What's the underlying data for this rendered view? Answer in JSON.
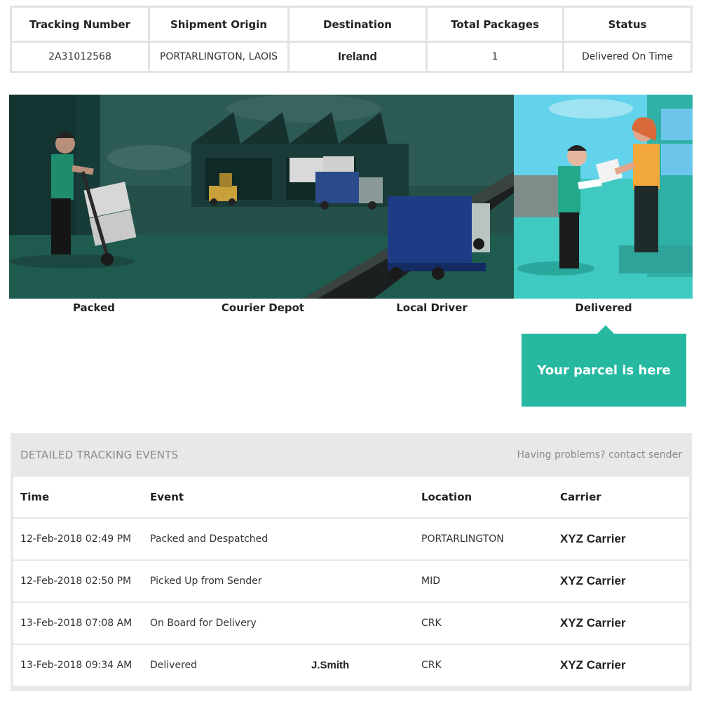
{
  "summary": {
    "headers": [
      "Tracking Number",
      "Shipment Origin",
      "Destination",
      "Total Packages",
      "Status"
    ],
    "values": [
      "2A31012568",
      "PORTARLINGTON, LAOIS",
      "Ireland",
      "1",
      "Delivered On Time"
    ]
  },
  "stages": [
    "Packed",
    "Courier Depot",
    "Local Driver",
    "Delivered"
  ],
  "callout": "Your parcel is here",
  "events": {
    "title": "DETAILED TRACKING EVENTS",
    "help_link": "Having problems? contact sender",
    "columns": [
      "Time",
      "Event",
      "Location",
      "Carrier"
    ],
    "rows": [
      {
        "time": "12-Feb-2018 02:49 PM",
        "event": "Packed and Despatched",
        "signature": "",
        "location": "PORTARLINGTON",
        "carrier": "XYZ Carrier"
      },
      {
        "time": "12-Feb-2018 02:50 PM",
        "event": "Picked Up from Sender",
        "signature": "",
        "location": "MID",
        "carrier": "XYZ Carrier"
      },
      {
        "time": "13-Feb-2018 07:08 AM",
        "event": "On Board for Delivery",
        "signature": "",
        "location": "CRK",
        "carrier": "XYZ Carrier"
      },
      {
        "time": "13-Feb-2018 09:34 AM",
        "event": "Delivered",
        "signature": "J.Smith",
        "location": "CRK",
        "carrier": "XYZ Carrier"
      }
    ]
  },
  "colors": {
    "accent": "#26b8a1",
    "banner_dark": "#1f4d47",
    "banner_active": "#40c9c0"
  }
}
